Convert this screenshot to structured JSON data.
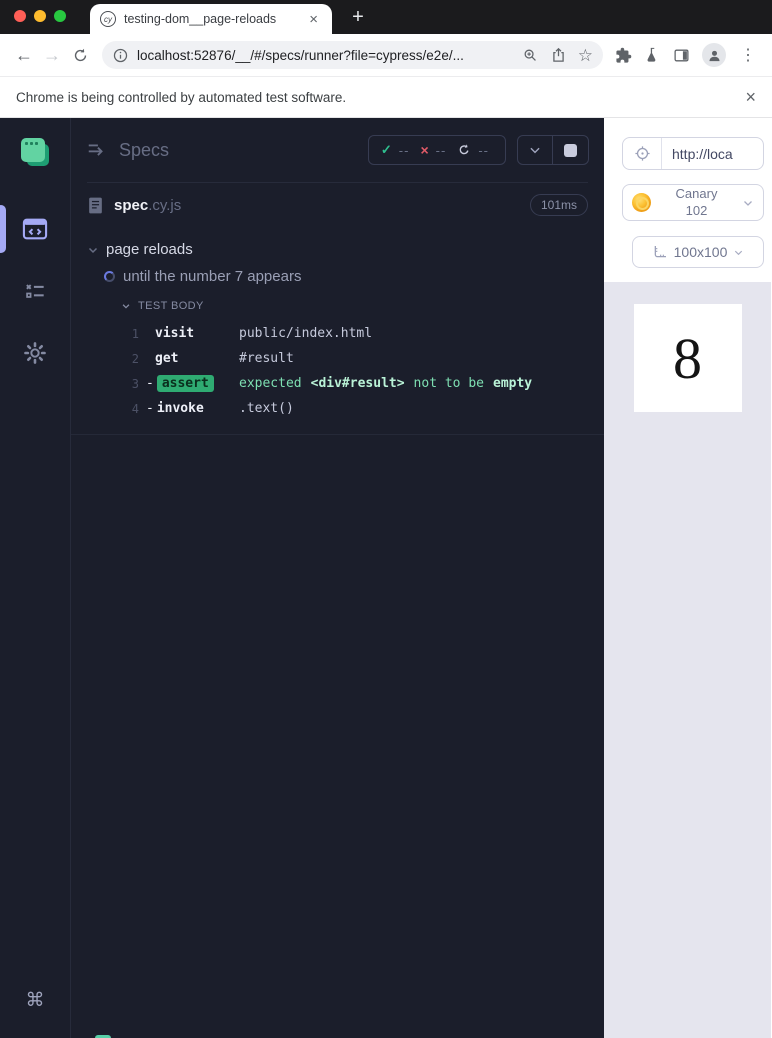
{
  "tab": {
    "title": "testing-dom__page-reloads",
    "favicon_label": "cy"
  },
  "toolbar": {
    "url": "localhost:52876/__/#/specs/runner?file=cypress/e2e/..."
  },
  "infobar": {
    "message": "Chrome is being controlled by automated test software."
  },
  "icons": {
    "tab_close": "×",
    "new_tab": "+",
    "back": "←",
    "forward": "→",
    "star": "☆",
    "menu_dots": "⋮",
    "infobar_close": "×",
    "command_key": "⌘",
    "check": "✓",
    "cross": "×"
  },
  "reporter": {
    "title": "Specs",
    "stats": {
      "passed": "--",
      "failed": "--",
      "pending": "--"
    },
    "spec_name": "spec",
    "spec_ext": ".cy.js",
    "spec_duration": "101ms",
    "suite_title": "page reloads",
    "test_title": "until the number 7 appears",
    "body_label": "TEST BODY",
    "commands": [
      {
        "n": "1",
        "name": "visit",
        "message": "public/index.html"
      },
      {
        "n": "2",
        "name": "get",
        "message": "#result"
      },
      {
        "n": "3",
        "name": "assert",
        "dash": "-",
        "parts": [
          "expected",
          "<div#result>",
          "not to be",
          "empty"
        ]
      },
      {
        "n": "4",
        "name": "invoke",
        "dash": "-",
        "message": ".text()"
      }
    ]
  },
  "aut": {
    "url": "http://loca",
    "browser_name": "Canary",
    "browser_version": "102",
    "viewport": "100x100",
    "result": "8"
  },
  "colors": {
    "accent_lavender": "#a5aaf5",
    "pass_green": "#2fbf8f",
    "fail_red": "#e15b68",
    "assert_badge_green": "#2fab72",
    "cypress_teal": "#62d3a2",
    "reporter_bg": "#1b1e2b"
  }
}
